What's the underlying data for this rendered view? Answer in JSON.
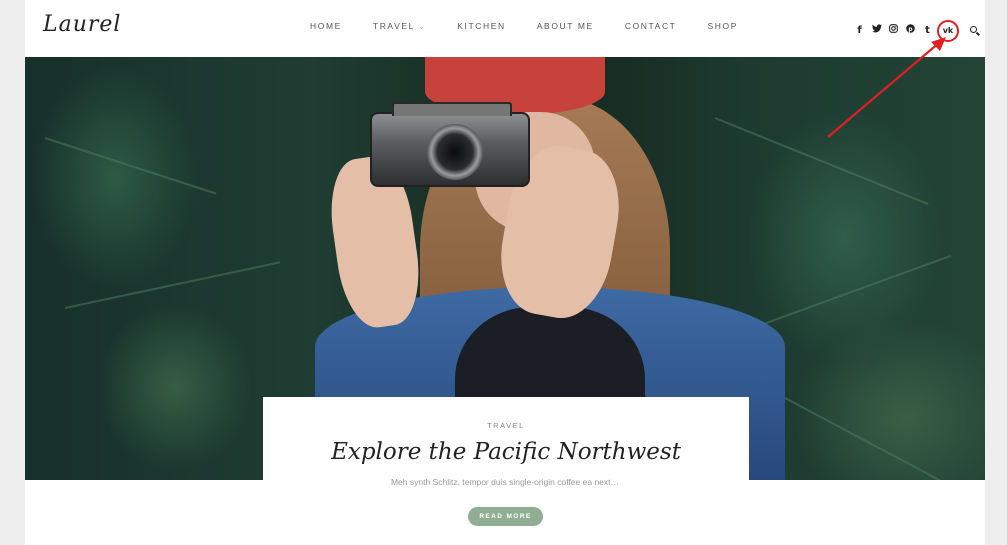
{
  "site": {
    "logo_text": "Laurel"
  },
  "nav": {
    "items": [
      {
        "label": "HOME"
      },
      {
        "label": "TRAVEL",
        "has_dropdown": true
      },
      {
        "label": "KITCHEN"
      },
      {
        "label": "ABOUT ME"
      },
      {
        "label": "CONTACT"
      },
      {
        "label": "SHOP"
      }
    ],
    "dropdown_glyph": "⌄"
  },
  "social": {
    "icons": [
      {
        "name": "facebook-icon",
        "glyph": "f"
      },
      {
        "name": "twitter-icon",
        "glyph": "🐦"
      },
      {
        "name": "instagram-icon",
        "glyph": "◎"
      },
      {
        "name": "pinterest-icon",
        "glyph": "℗"
      },
      {
        "name": "tumblr-icon",
        "glyph": "t"
      },
      {
        "name": "vk-icon",
        "glyph": "vk"
      }
    ],
    "highlight_color": "#e02020"
  },
  "hero": {
    "category": "TRAVEL",
    "title": "Explore the Pacific Northwest",
    "excerpt": "Meh synth Schlitz, tempor duis single-origin coffee ea next…",
    "read_more": "READ MORE",
    "button_color": "#8fae93"
  },
  "annotation": {
    "color": "#e02020"
  }
}
